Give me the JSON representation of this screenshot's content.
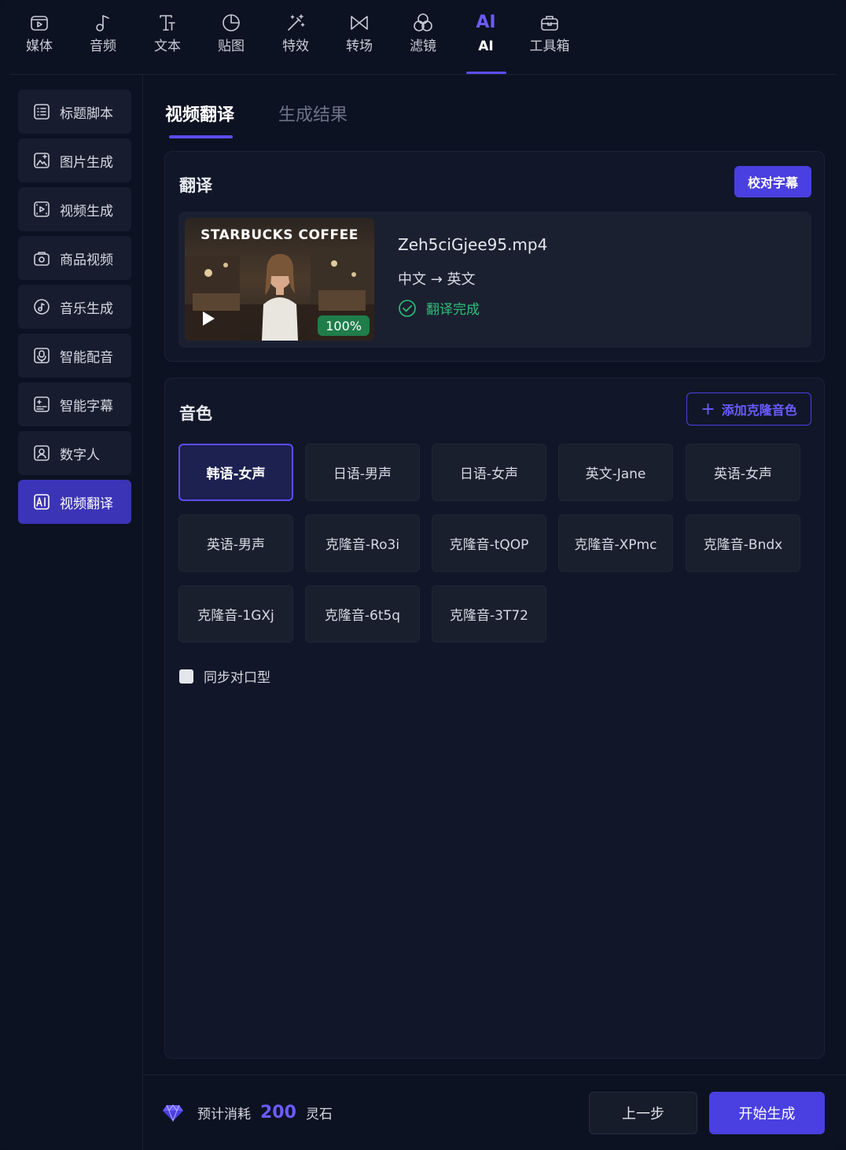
{
  "toolbar": {
    "items": [
      {
        "label": "媒体",
        "icon": "media-icon"
      },
      {
        "label": "音频",
        "icon": "music-note-icon"
      },
      {
        "label": "文本",
        "icon": "text-icon"
      },
      {
        "label": "贴图",
        "icon": "sticker-icon"
      },
      {
        "label": "特效",
        "icon": "magic-wand-icon"
      },
      {
        "label": "转场",
        "icon": "transition-icon"
      },
      {
        "label": "滤镜",
        "icon": "filter-icon"
      },
      {
        "label": "AI",
        "icon_text": "AI"
      },
      {
        "label": "工具箱",
        "icon": "toolbox-icon"
      }
    ],
    "active_index": 7
  },
  "sidebar": {
    "items": [
      {
        "label": "标题脚本",
        "icon": "script-icon"
      },
      {
        "label": "图片生成",
        "icon": "image-icon"
      },
      {
        "label": "视频生成",
        "icon": "video-icon"
      },
      {
        "label": "商品视频",
        "icon": "bag-icon"
      },
      {
        "label": "音乐生成",
        "icon": "music-icon"
      },
      {
        "label": "智能配音",
        "icon": "voice-icon"
      },
      {
        "label": "智能字幕",
        "icon": "subtitle-icon"
      },
      {
        "label": "数字人",
        "icon": "avatar-icon"
      },
      {
        "label": "视频翻译",
        "icon": "ai-icon"
      }
    ],
    "active_index": 8
  },
  "tabs": {
    "translate": "视频翻译",
    "results": "生成结果"
  },
  "translation": {
    "title": "翻译",
    "proofread_button": "校对字幕",
    "video": {
      "thumb_title": "STARBUCKS COFFEE",
      "progress": "100%",
      "file_name": "Zeh5ciGjee95.mp4",
      "lang_pair": "中文 → 英文",
      "status": "翻译完成"
    }
  },
  "voices": {
    "title": "音色",
    "add_clone_button": "添加克隆音色",
    "list": [
      "韩语-女声",
      "日语-男声",
      "日语-女声",
      "英文-Jane",
      "英语-女声",
      "英语-男声",
      "克隆音-Ro3i",
      "克隆音-tQOP",
      "克隆音-XPmc",
      "克隆音-Bndx",
      "克隆音-1GXj",
      "克隆音-6t5q",
      "克隆音-3T72"
    ],
    "selected_index": 0,
    "lip_sync_label": "同步对口型"
  },
  "footer": {
    "cost_prefix": "预计消耗",
    "cost_value": "200",
    "cost_unit": "灵石",
    "prev_button": "上一步",
    "start_button": "开始生成"
  },
  "colors": {
    "accent": "#4a3fe0",
    "accent_text": "#6a5cff",
    "success": "#2fbf7a",
    "background": "#0d1222"
  }
}
